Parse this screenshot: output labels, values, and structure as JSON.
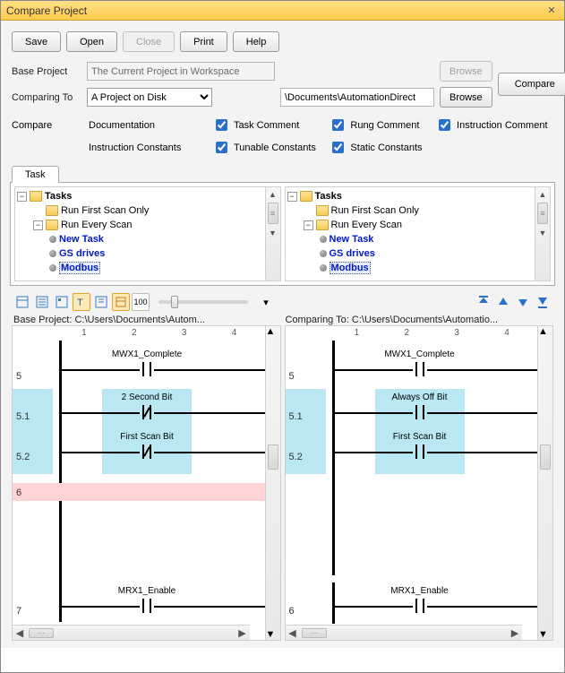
{
  "window": {
    "title": "Compare Project"
  },
  "buttons": {
    "save": "Save",
    "open": "Open",
    "close": "Close",
    "print": "Print",
    "help": "Help",
    "compare": "Compare",
    "browse1": "Browse",
    "browse2": "Browse"
  },
  "form": {
    "base_label": "Base Project",
    "base_value": "The Current Project in Workspace",
    "comp_label": "Comparing To",
    "comp_select": "A Project on Disk",
    "comp_path": "\\Documents\\AutomationDirect"
  },
  "opts": {
    "compare_label": "Compare",
    "doc_label": "Documentation",
    "task_comment": "Task Comment",
    "rung_comment": "Rung Comment",
    "instr_comment": "Instruction Comment",
    "ic_label": "Instruction Constants",
    "tunable": "Tunable Constants",
    "static": "Static Constants"
  },
  "tab": {
    "task": "Task"
  },
  "tree": {
    "root": "Tasks",
    "run_first": "Run First Scan Only",
    "run_every": "Run Every Scan",
    "new_task": "New Task",
    "gs_drives": "GS drives",
    "modbus": "Modbus"
  },
  "toolbar": {
    "hundred": "100"
  },
  "paths": {
    "base": "Base Project: C:\\Users\\Documents\\Autom...",
    "comp": "Comparing To: C:\\Users\\Documents\\Automatio..."
  },
  "ruler": {
    "c1": "1",
    "c2": "2",
    "c3": "3",
    "c4": "4"
  },
  "rungs": {
    "r5": "5",
    "r51": "5.1",
    "r52": "5.2",
    "r6": "6",
    "r7l": "7",
    "r7r": "6"
  },
  "labels": {
    "mwx1_complete": "MWX1_Complete",
    "two_sec": "2 Second Bit",
    "always_off": "Always Off Bit",
    "first_scan": "First Scan Bit",
    "mrx1_enable": "MRX1_Enable"
  }
}
